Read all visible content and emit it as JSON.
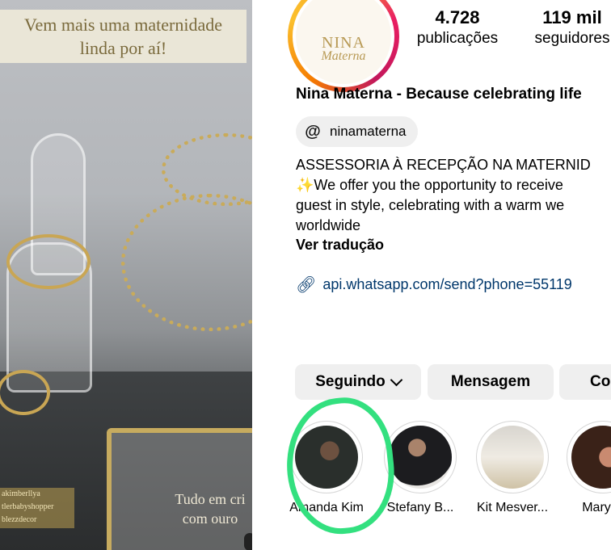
{
  "story": {
    "caption_top_line1": "Vem mais uma maternidade",
    "caption_top_line2": "linda por aí!",
    "tags": [
      "akimberllya",
      "tlerbabyshopper",
      "blezzdecor"
    ],
    "tray_text_line1": "Tudo em cri",
    "tray_text_line2": "com ouro"
  },
  "profile": {
    "avatar_logo_line1": "NINA",
    "avatar_logo_line2": "Materna",
    "stats": [
      {
        "number": "4.728",
        "label": "publicações"
      },
      {
        "number": "119 mil",
        "label": "seguidores"
      }
    ],
    "name": "Nina Materna - Because celebrating life",
    "threads_handle": "ninamaterna",
    "threads_icon": "threads-icon",
    "bio_lines": [
      "ASSESSORIA À RECEPÇÃO NA MATERNID",
      "✨We offer you the opportunity to receive",
      "guest in style, celebrating with a warm we",
      "worldwide"
    ],
    "translate_label": "Ver tradução",
    "link_text": "api.whatsapp.com/send?phone=55119",
    "link_icon": "link-icon"
  },
  "buttons": {
    "following_label": "Seguindo",
    "message_label": "Mensagem",
    "contact_label": "Co"
  },
  "highlights": [
    {
      "label": "Amanda Kim"
    },
    {
      "label": "Stefany B..."
    },
    {
      "label": "Kit Mesver..."
    },
    {
      "label": "Mary N"
    }
  ],
  "colors": {
    "link": "#00376b",
    "button_bg": "#efefef",
    "annotation": "#33e07f"
  }
}
